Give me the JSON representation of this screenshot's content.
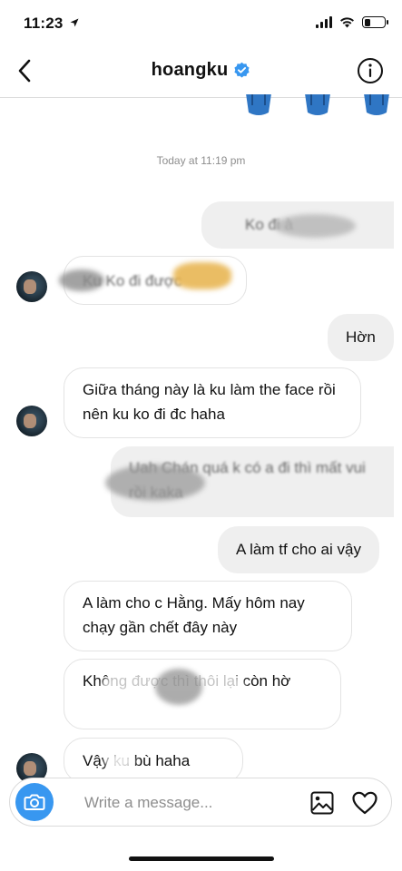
{
  "status_bar": {
    "time": "11:23"
  },
  "header": {
    "title": "hoangku"
  },
  "timestamp": "Today at 11:19 pm",
  "messages": [
    {
      "side": "out",
      "text": "Ko đi à",
      "redacted": true
    },
    {
      "side": "in",
      "text": "Ku Ko đi được",
      "redacted": true
    },
    {
      "side": "out",
      "text": "Hờn",
      "redacted": false
    },
    {
      "side": "in",
      "text": "Giữa tháng này là ku làm the face rồi nên ku ko đi đc haha",
      "redacted": false
    },
    {
      "side": "out",
      "text": "Uah Chán quá k có a đi thì mất vui rồi kaka",
      "redacted": true
    },
    {
      "side": "out",
      "text": "A làm tf cho ai vậy",
      "redacted": false
    },
    {
      "side": "in",
      "text": "A làm cho c Hằng. Mấy hôm nay chạy gần chết đây này",
      "redacted": false
    },
    {
      "side": "in",
      "text": "Không được thì thôi lại còn hờ",
      "redacted": true
    },
    {
      "side": "in",
      "text": "Vậy ku bù haha",
      "redacted": true
    }
  ],
  "composer": {
    "placeholder": "Write a message..."
  },
  "icons": {
    "back": "chevron-left-icon",
    "verified": "verified-badge-icon",
    "info": "info-icon",
    "camera": "camera-icon",
    "gallery": "image-icon",
    "heart": "heart-icon"
  },
  "colors": {
    "accent": "#3897f0",
    "outgoing_bubble": "#efefef",
    "incoming_border": "#e3e3e3",
    "timestamp": "#8e8e8e"
  }
}
